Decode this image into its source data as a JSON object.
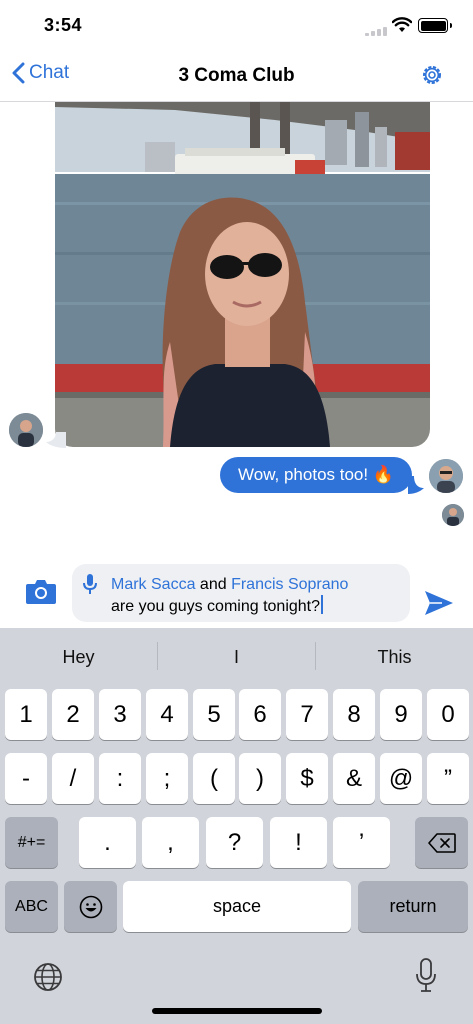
{
  "status_bar": {
    "time": "3:54"
  },
  "nav": {
    "back_label": "Chat",
    "title": "3 Coma Club"
  },
  "messages": {
    "outgoing_text": "Wow, photos too! 🔥"
  },
  "composer": {
    "mention_1": "Mark Sacca",
    "connector": " and ",
    "mention_2": "Francis Soprano",
    "line_2": "are you guys coming tonight?"
  },
  "suggestions": [
    "Hey",
    "I",
    "This"
  ],
  "keyboard": {
    "row1": [
      "1",
      "2",
      "3",
      "4",
      "5",
      "6",
      "7",
      "8",
      "9",
      "0"
    ],
    "row2": [
      "-",
      "/",
      ":",
      ";",
      "(",
      ")",
      "$",
      "&",
      "@",
      "”"
    ],
    "row3": [
      ".",
      ",",
      "?",
      "!",
      "’"
    ],
    "symbols_label": "#+=",
    "abc_label": "ABC",
    "space_label": "space",
    "return_label": "return"
  },
  "colors": {
    "accent": "#2f73d9",
    "keyboard_bg": "#d1d4da"
  }
}
